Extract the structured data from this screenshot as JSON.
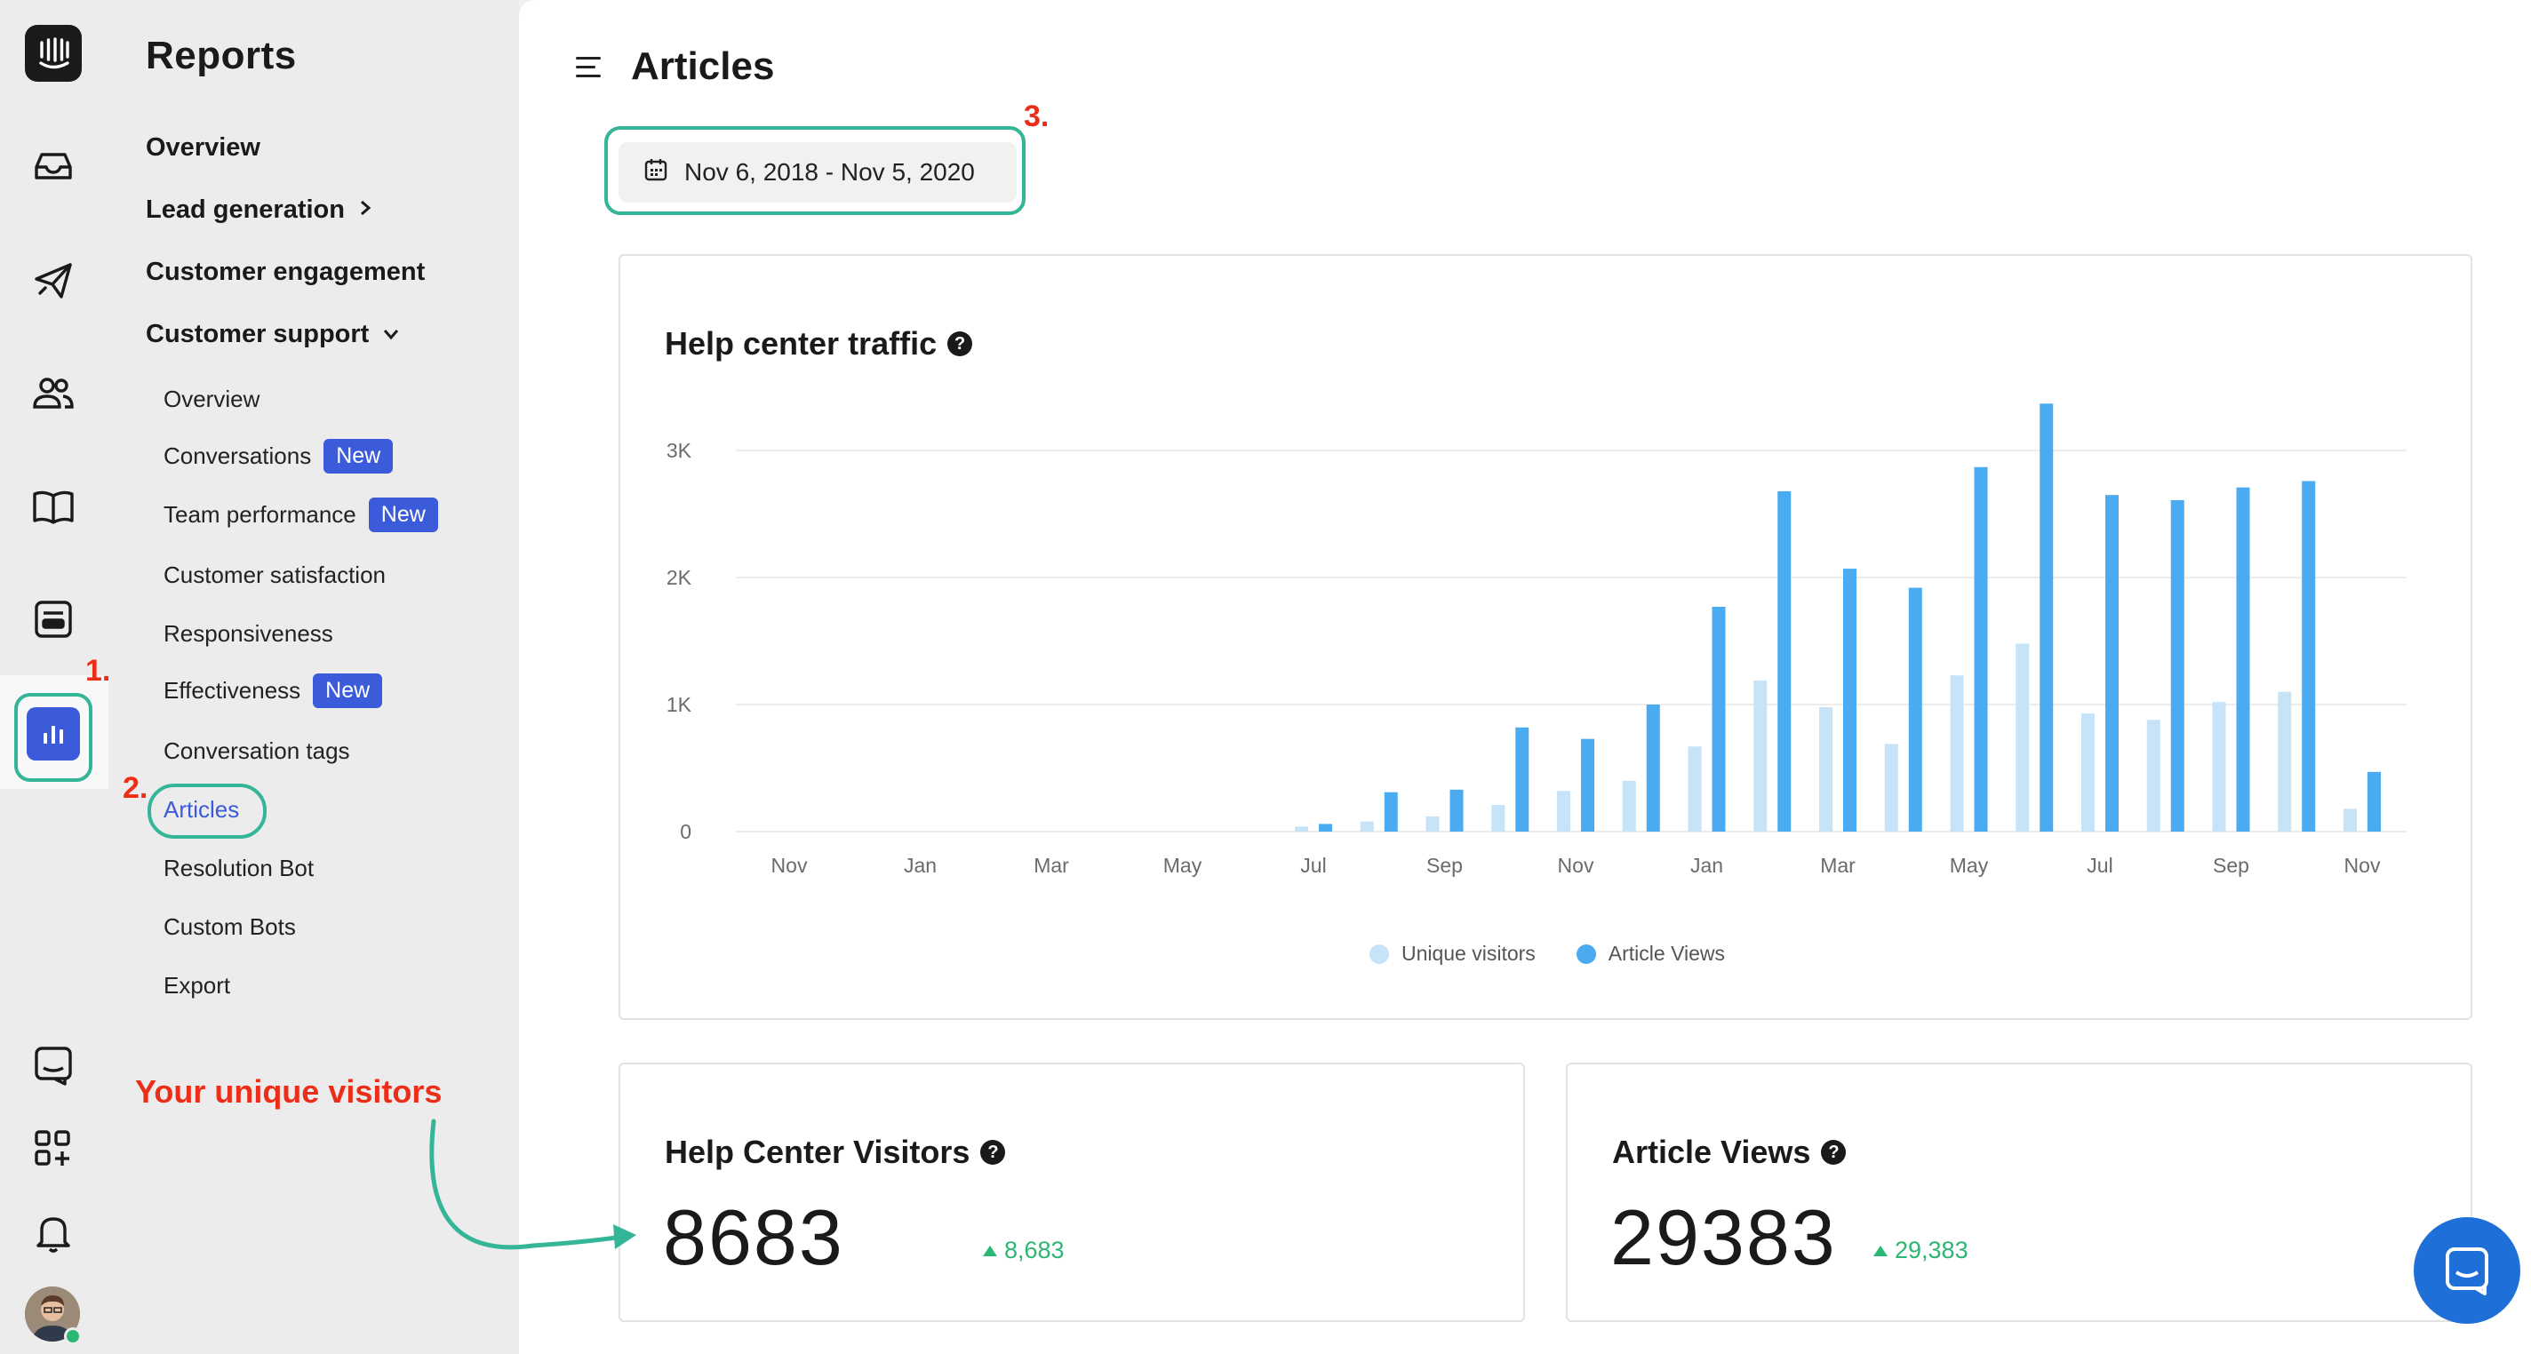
{
  "sidebar": {
    "title": "Reports",
    "items": [
      {
        "label": "Overview"
      },
      {
        "label": "Lead generation"
      },
      {
        "label": "Customer engagement"
      },
      {
        "label": "Customer support"
      }
    ],
    "subitems": [
      {
        "label": "Overview"
      },
      {
        "label": "Conversations",
        "badge": "New"
      },
      {
        "label": "Team performance",
        "badge": "New"
      },
      {
        "label": "Customer satisfaction"
      },
      {
        "label": "Responsiveness"
      },
      {
        "label": "Effectiveness",
        "badge": "New"
      },
      {
        "label": "Conversation tags"
      },
      {
        "label": "Articles"
      },
      {
        "label": "Resolution Bot"
      },
      {
        "label": "Custom Bots"
      },
      {
        "label": "Export"
      }
    ]
  },
  "header": {
    "title": "Articles",
    "date_range": "Nov 6, 2018 - Nov 5, 2020"
  },
  "chart_card": {
    "title": "Help center traffic",
    "legend": [
      "Unique visitors",
      "Article Views"
    ]
  },
  "stats": [
    {
      "title": "Help Center Visitors",
      "value": "8683",
      "delta": "8,683"
    },
    {
      "title": "Article Views",
      "value": "29383",
      "delta": "29,383"
    }
  ],
  "annotations": {
    "step1": "1.",
    "step2": "2.",
    "step3": "3.",
    "callout": "Your unique visitors"
  },
  "colors": {
    "accent": "#3b5bdb",
    "unique_visitors": "#c6e3f7",
    "article_views": "#4aabf0",
    "positive": "#2bb673",
    "annotation": "#ec2d17",
    "highlight_ring": "#35b597"
  },
  "icons": [
    "intercom-logo-icon",
    "inbox-icon",
    "outbound-icon",
    "contacts-icon",
    "articles-book-icon",
    "inbox-template-icon",
    "reports-icon",
    "messenger-preview-icon",
    "app-store-icon",
    "notifications-bell-icon",
    "calendar-icon",
    "menu-icon",
    "help-icon",
    "messenger-launcher-icon",
    "chevron-right-icon",
    "chevron-down-icon"
  ],
  "chart_data": {
    "type": "bar",
    "title": "Help center traffic",
    "xlabel": "",
    "ylabel": "",
    "ylim": [
      0,
      3400
    ],
    "yticks": [
      {
        "value": 0,
        "label": "0"
      },
      {
        "value": 1000,
        "label": "1K"
      },
      {
        "value": 2000,
        "label": "2K"
      },
      {
        "value": 3000,
        "label": "3K"
      }
    ],
    "xtick_labels": [
      "Nov",
      "Jan",
      "Mar",
      "May",
      "Jul",
      "Sep",
      "Nov",
      "Jan",
      "Mar",
      "May",
      "Jul",
      "Sep",
      "Nov"
    ],
    "categories": [
      "Nov 2018",
      "Dec 2018",
      "Jan 2019",
      "Feb 2019",
      "Mar 2019",
      "Apr 2019",
      "May 2019",
      "Jun 2019",
      "Jul 2019",
      "Aug 2019",
      "Sep 2019",
      "Oct 2019",
      "Nov 2019",
      "Dec 2019",
      "Jan 2020",
      "Feb 2020",
      "Mar 2020",
      "Apr 2020",
      "May 2020",
      "Jun 2020",
      "Jul 2020",
      "Aug 2020",
      "Sep 2020",
      "Oct 2020",
      "Nov 2020"
    ],
    "series": [
      {
        "name": "Unique visitors",
        "values": [
          0,
          0,
          0,
          0,
          0,
          0,
          0,
          0,
          40,
          80,
          120,
          210,
          320,
          400,
          670,
          1190,
          980,
          690,
          1230,
          1480,
          930,
          880,
          1020,
          1100,
          180
        ]
      },
      {
        "name": "Article Views",
        "values": [
          0,
          0,
          0,
          0,
          0,
          0,
          0,
          0,
          60,
          310,
          330,
          820,
          730,
          1000,
          1770,
          2680,
          2070,
          1920,
          2870,
          3370,
          2650,
          2610,
          2710,
          2760,
          470
        ]
      }
    ]
  }
}
